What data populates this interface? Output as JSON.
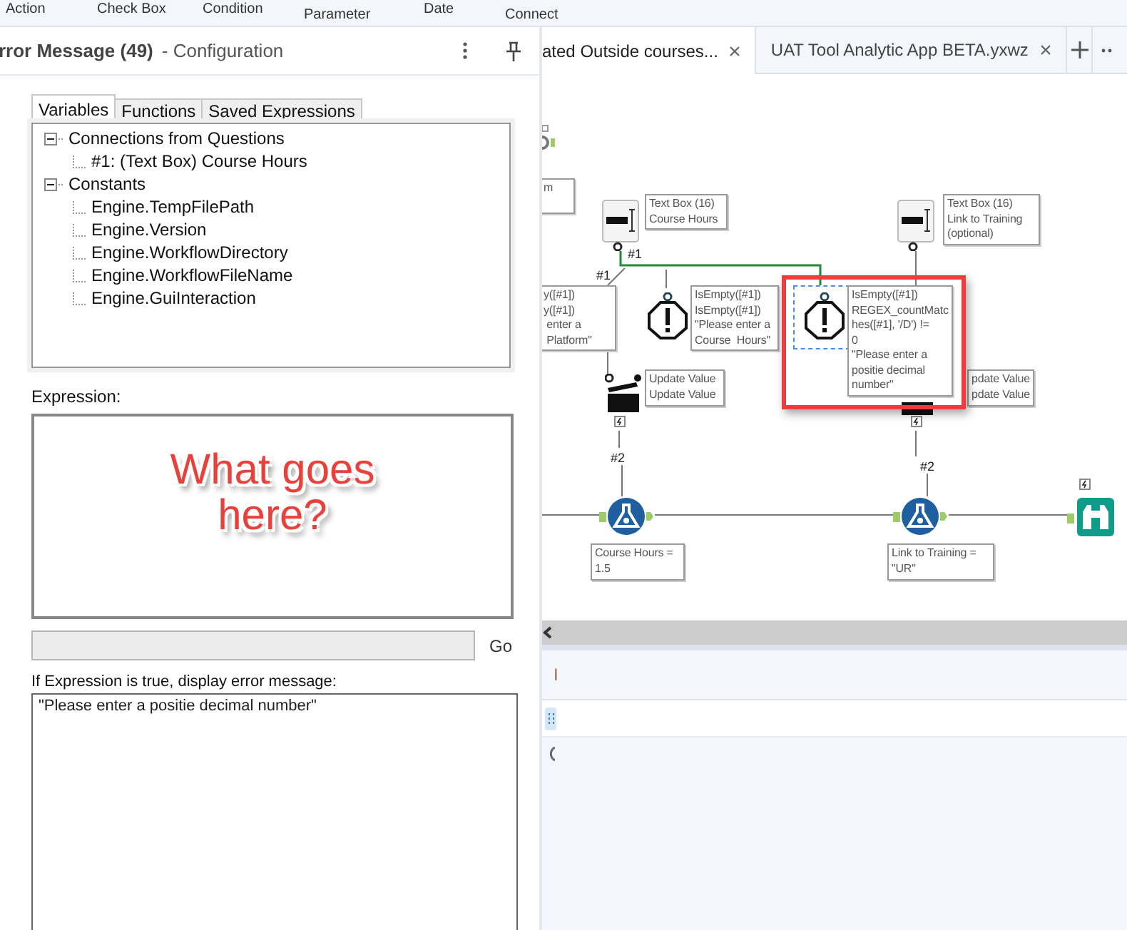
{
  "ribbon": [
    "Action",
    "Check Box",
    "Condition",
    "Parameter",
    "Date",
    "Connect"
  ],
  "config": {
    "title": "rror Message (49)",
    "subtitle": "- Configuration",
    "tabs": [
      {
        "label": "Variables",
        "selected": true
      },
      {
        "label": "Functions",
        "selected": false
      },
      {
        "label": "Saved Expressions",
        "selected": false
      }
    ],
    "tree": [
      {
        "label": "Connections from Questions",
        "expanded": true,
        "children": [
          {
            "label": "#1: (Text Box) Course Hours"
          }
        ]
      },
      {
        "label": "Constants",
        "expanded": true,
        "children": [
          {
            "label": "Engine.TempFilePath"
          },
          {
            "label": "Engine.Version"
          },
          {
            "label": "Engine.WorkflowDirectory"
          },
          {
            "label": "Engine.WorkflowFileName"
          },
          {
            "label": "Engine.GuiInteraction"
          }
        ]
      }
    ],
    "expression_label": "Expression:",
    "overlay_note": "What goes\nhere?",
    "go_button": "Go",
    "message_label": "If Expression is true, display error message:",
    "message": "\"Please enter a positie decimal number\""
  },
  "workflow_tabs": [
    {
      "label": "ated Outside courses...",
      "selected": true
    },
    {
      "label": "UAT Tool Analytic App BETA.yxwz",
      "selected": false
    }
  ],
  "canvas": {
    "tools": [
      {
        "kind": "text_box",
        "selected": false
      },
      {
        "kind": "text_box",
        "selected": false
      },
      {
        "kind": "error",
        "selected": false
      },
      {
        "kind": "error",
        "selected": true
      },
      {
        "kind": "action",
        "selected": false
      },
      {
        "kind": "action_bar",
        "selected": false
      },
      {
        "kind": "formula",
        "selected": false
      },
      {
        "kind": "formula",
        "selected": false
      },
      {
        "kind": "browse",
        "selected": false
      }
    ],
    "annotations": [
      {
        "text": "m"
      },
      {
        "text": "Text Box (16)\nCourse Hours"
      },
      {
        "text": "Text Box (16)\nLink to Training\n(optional)"
      },
      {
        "text": "y([#1])\ny([#1])\n enter a\n Platform\""
      },
      {
        "text": "IsEmpty([#1])\nIsEmpty([#1])\n\"Please enter a\nCourse  Hours\""
      },
      {
        "text": "IsEmpty([#1])\nREGEX_countMatc\nhes([#1], '/D') !=\n0\n\"Please enter a\npositie decimal\nnumber\""
      },
      {
        "text": "Update Value\nUpdate Value"
      },
      {
        "text": "pdate Value\npdate Value"
      },
      {
        "text": "Course Hours =\n1.5"
      },
      {
        "text": "Link to Training =\n\"UR\""
      }
    ],
    "labels": [
      "#1",
      "#1",
      "#2",
      "#2"
    ]
  },
  "bottom_panel": {
    "label": "I"
  }
}
